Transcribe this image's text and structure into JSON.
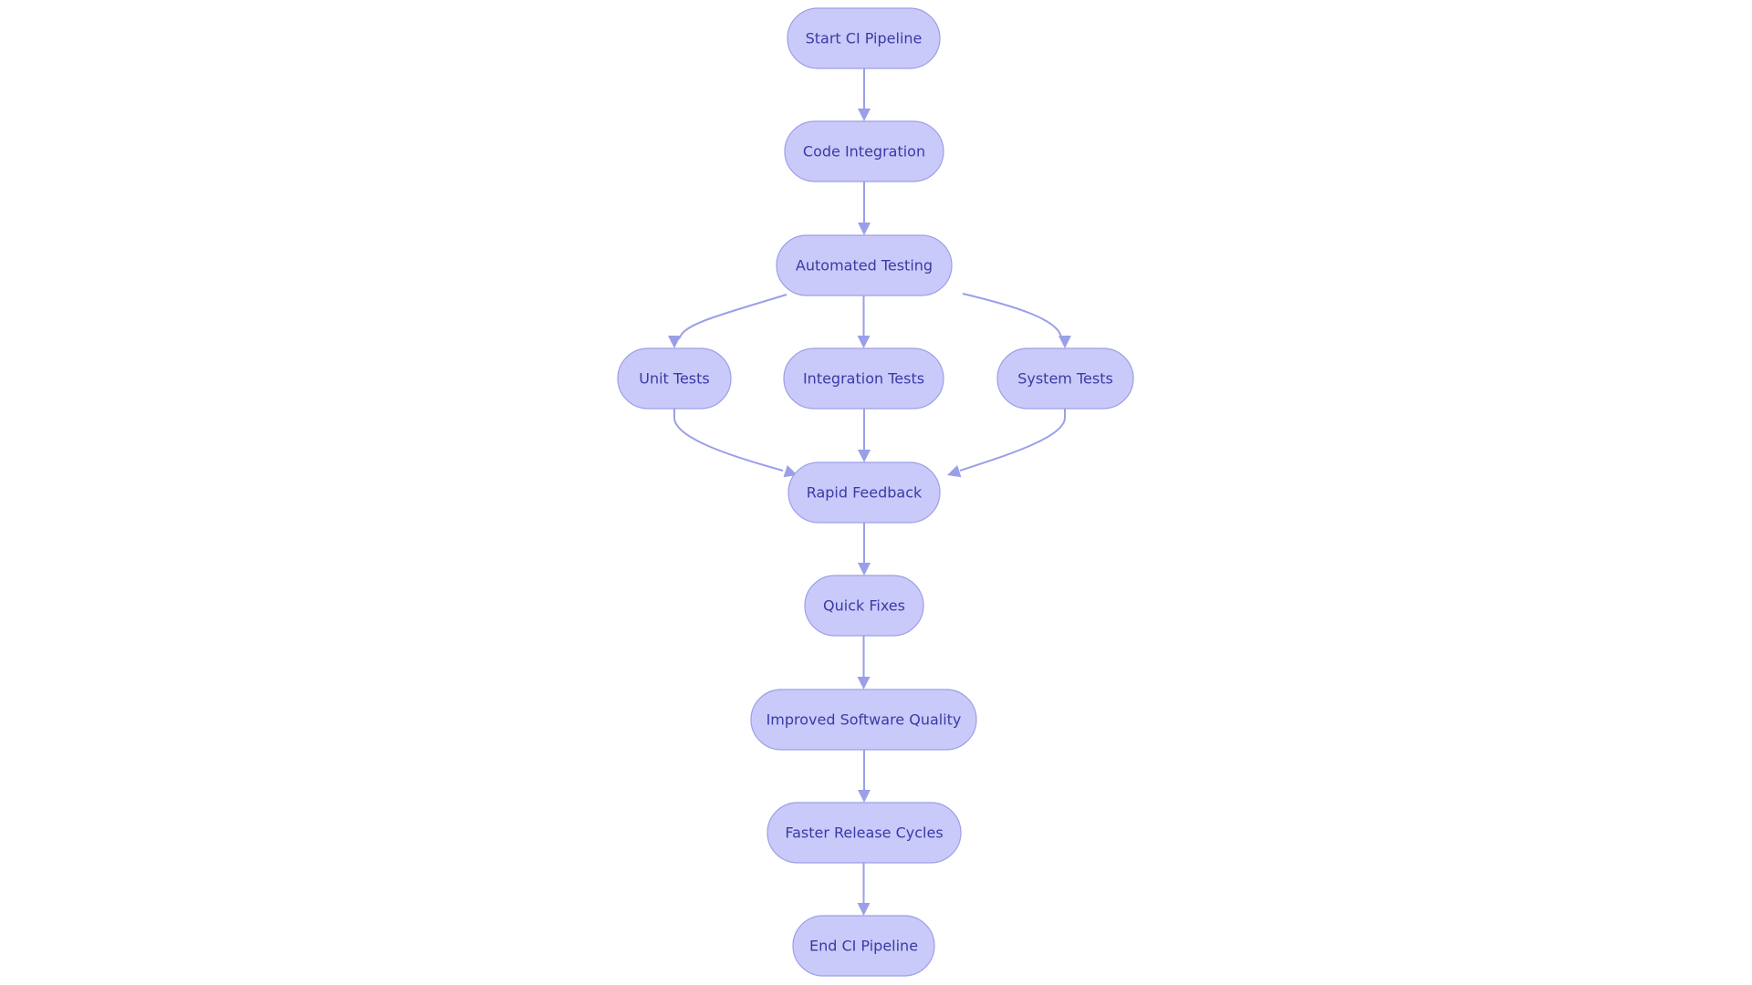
{
  "diagram": {
    "type": "flowchart",
    "direction": "top-to-bottom",
    "colors": {
      "node_fill": "#cacafa",
      "node_stroke": "#9c9fe6",
      "text": "#3a3aa6",
      "edge": "#9a9fe8",
      "background": "#ffffff"
    },
    "nodes": [
      {
        "id": "start",
        "label": "Start CI Pipeline"
      },
      {
        "id": "code",
        "label": "Code Integration"
      },
      {
        "id": "auto",
        "label": "Automated Testing"
      },
      {
        "id": "unit",
        "label": "Unit Tests"
      },
      {
        "id": "integ",
        "label": "Integration Tests"
      },
      {
        "id": "system",
        "label": "System Tests"
      },
      {
        "id": "rapid",
        "label": "Rapid Feedback"
      },
      {
        "id": "quick",
        "label": "Quick Fixes"
      },
      {
        "id": "improved",
        "label": "Improved Software Quality"
      },
      {
        "id": "faster",
        "label": "Faster Release Cycles"
      },
      {
        "id": "end",
        "label": "End CI Pipeline"
      }
    ],
    "edges": [
      {
        "from": "start",
        "to": "code"
      },
      {
        "from": "code",
        "to": "auto"
      },
      {
        "from": "auto",
        "to": "unit"
      },
      {
        "from": "auto",
        "to": "integ"
      },
      {
        "from": "auto",
        "to": "system"
      },
      {
        "from": "unit",
        "to": "rapid"
      },
      {
        "from": "integ",
        "to": "rapid"
      },
      {
        "from": "system",
        "to": "rapid"
      },
      {
        "from": "rapid",
        "to": "quick"
      },
      {
        "from": "quick",
        "to": "improved"
      },
      {
        "from": "improved",
        "to": "faster"
      },
      {
        "from": "faster",
        "to": "end"
      }
    ]
  }
}
